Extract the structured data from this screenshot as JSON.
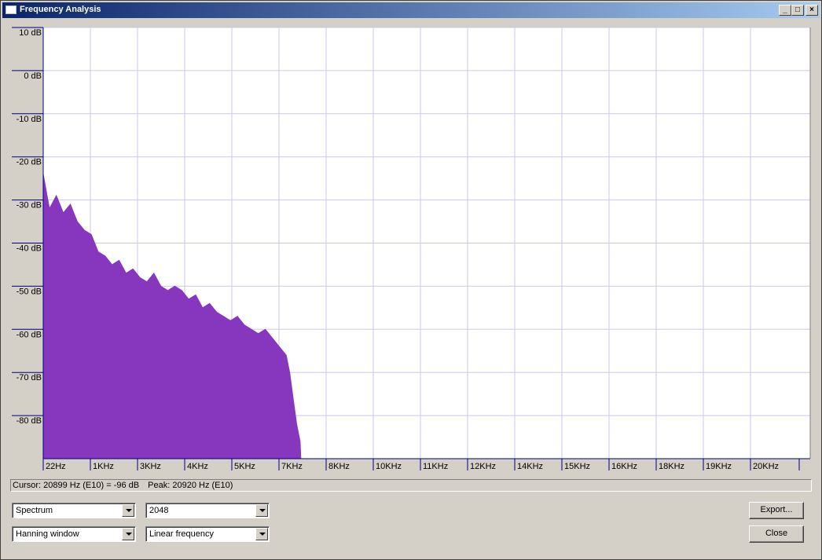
{
  "window": {
    "title": "Frequency Analysis"
  },
  "titlebar_buttons": {
    "minimize": "_",
    "maximize": "□",
    "close": "×"
  },
  "colors": {
    "spectrum_fill": "#8637be",
    "grid": "#c8c8ec",
    "axis": "#000080"
  },
  "chart_data": {
    "type": "area",
    "ylim": [
      -90,
      10
    ],
    "y_ticks": [
      "10 dB",
      "0 dB",
      "-10 dB",
      "-20 dB",
      "-30 dB",
      "-40 dB",
      "-50 dB",
      "-60 dB",
      "-70 dB",
      "-80 dB"
    ],
    "x_ticks": [
      "22Hz",
      "1KHz",
      "3KHz",
      "4KHz",
      "5KHz",
      "7KHz",
      "8KHz",
      "10KHz",
      "11KHz",
      "12KHz",
      "14KHz",
      "15KHz",
      "16KHz",
      "18KHz",
      "19KHz",
      "20KHz"
    ],
    "xlim": [
      22,
      22050
    ],
    "series": [
      {
        "x": [
          22,
          200,
          400,
          600,
          800,
          1000,
          1200,
          1400,
          1600,
          1800,
          2000,
          2200,
          2400,
          2600,
          2800,
          3000,
          3200,
          3400,
          3600,
          3800,
          4000,
          4200,
          4400,
          4600,
          4800,
          5000,
          5200,
          5400,
          5600,
          5800,
          6000,
          6200,
          6400,
          6600,
          6800,
          7000,
          7100,
          7200,
          7300,
          7400,
          7420
        ],
        "y": [
          -24,
          -32,
          -29,
          -33,
          -31,
          -35,
          -37,
          -38,
          -42,
          -43,
          -45,
          -44,
          -47,
          -46,
          -48,
          -49,
          -47,
          -50,
          -51,
          -50,
          -51,
          -53,
          -52,
          -55,
          -54,
          -56,
          -57,
          -58,
          -57,
          -59,
          -60,
          -61,
          -60,
          -62,
          -64,
          -66,
          -70,
          -76,
          -82,
          -86,
          -90
        ]
      }
    ]
  },
  "status": {
    "cursor": "Cursor: 20899 Hz (E10) = -96 dB",
    "peak": "Peak: 20920 Hz (E10)"
  },
  "controls": {
    "algorithm": "Spectrum",
    "size": "2048",
    "window_func": "Hanning window",
    "axis": "Linear frequency"
  },
  "buttons": {
    "export": "Export...",
    "close": "Close"
  }
}
